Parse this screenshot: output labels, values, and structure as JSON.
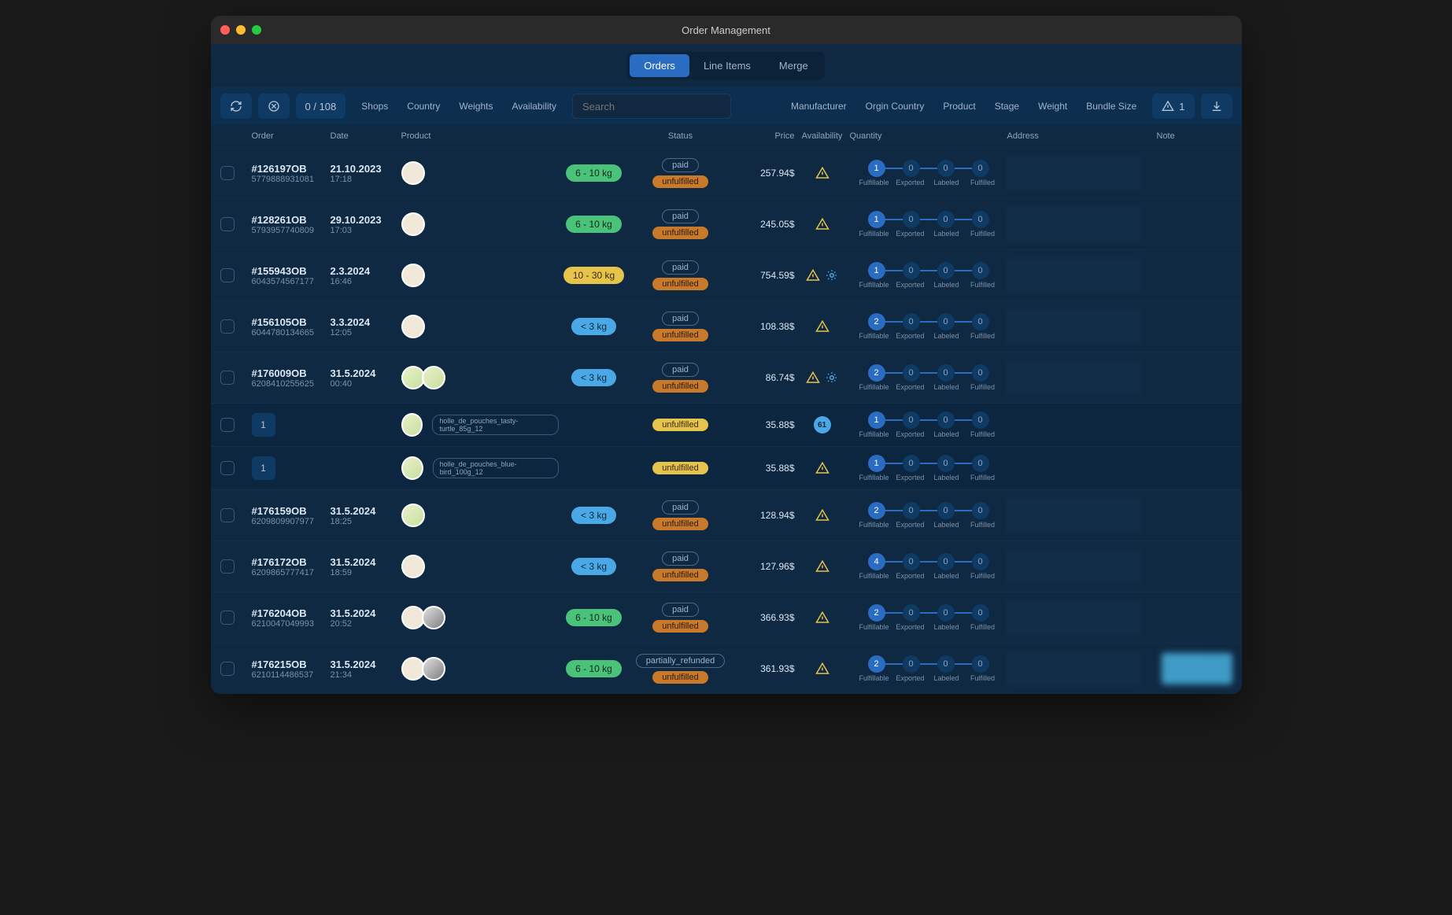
{
  "window": {
    "title": "Order Management"
  },
  "tabs": [
    {
      "label": "Orders",
      "active": true
    },
    {
      "label": "Line Items",
      "active": false
    },
    {
      "label": "Merge",
      "active": false
    }
  ],
  "toolbar": {
    "count": "0 / 108",
    "search_placeholder": "Search",
    "filters_left": [
      "Shops",
      "Country",
      "Weights",
      "Availability"
    ],
    "filters_right": [
      "Manufacturer",
      "Orgin Country",
      "Product",
      "Stage",
      "Weight",
      "Bundle Size"
    ],
    "alert_count": "1"
  },
  "columns": [
    "Order",
    "Date",
    "Product",
    "Status",
    "Price",
    "Availability",
    "Quantity",
    "Address",
    "Note"
  ],
  "qty_labels": [
    "Fulfillable",
    "Exported",
    "Labeled",
    "Fulfilled"
  ],
  "rows": [
    {
      "type": "order",
      "order_id": "#126197OB",
      "order_sub": "5779888931081",
      "date": "21.10.2023",
      "time": "17:18",
      "thumbs": [
        "plain"
      ],
      "weight": "6 - 10 kg",
      "weight_class": "w-green",
      "statuses": [
        {
          "label": "paid",
          "cls": "s-paid"
        },
        {
          "label": "unfulfilled",
          "cls": "s-unf"
        }
      ],
      "price": "257.94$",
      "avail": [
        "warn"
      ],
      "qty": [
        1,
        0,
        0,
        0
      ]
    },
    {
      "type": "order",
      "order_id": "#128261OB",
      "order_sub": "5793957740809",
      "date": "29.10.2023",
      "time": "17:03",
      "thumbs": [
        "plain"
      ],
      "weight": "6 - 10 kg",
      "weight_class": "w-green",
      "statuses": [
        {
          "label": "paid",
          "cls": "s-paid"
        },
        {
          "label": "unfulfilled",
          "cls": "s-unf"
        }
      ],
      "price": "245.05$",
      "avail": [
        "warn"
      ],
      "qty": [
        1,
        0,
        0,
        0
      ]
    },
    {
      "type": "order",
      "order_id": "#155943OB",
      "order_sub": "6043574567177",
      "date": "2.3.2024",
      "time": "16:46",
      "thumbs": [
        "plain"
      ],
      "weight": "10 - 30 kg",
      "weight_class": "w-yellow",
      "statuses": [
        {
          "label": "paid",
          "cls": "s-paid"
        },
        {
          "label": "unfulfilled",
          "cls": "s-unf"
        }
      ],
      "price": "754.59$",
      "avail": [
        "warn",
        "split"
      ],
      "qty": [
        1,
        0,
        0,
        0
      ]
    },
    {
      "type": "order",
      "order_id": "#156105OB",
      "order_sub": "6044780134665",
      "date": "3.3.2024",
      "time": "12:05",
      "thumbs": [
        "plain"
      ],
      "weight": "< 3 kg",
      "weight_class": "w-blue",
      "statuses": [
        {
          "label": "paid",
          "cls": "s-paid"
        },
        {
          "label": "unfulfilled",
          "cls": "s-unf"
        }
      ],
      "price": "108.38$",
      "avail": [
        "warn"
      ],
      "qty": [
        2,
        0,
        0,
        0
      ]
    },
    {
      "type": "order",
      "order_id": "#176009OB",
      "order_sub": "6208410255625",
      "date": "31.5.2024",
      "time": "00:40",
      "thumbs": [
        "pouch",
        "pouch"
      ],
      "weight": "< 3 kg",
      "weight_class": "w-blue",
      "statuses": [
        {
          "label": "paid",
          "cls": "s-paid"
        },
        {
          "label": "unfulfilled",
          "cls": "s-unf"
        }
      ],
      "price": "86.74$",
      "avail": [
        "warn",
        "split"
      ],
      "qty": [
        2,
        0,
        0,
        0
      ]
    },
    {
      "type": "sub",
      "sub_count": "1",
      "thumbs": [
        "pouch"
      ],
      "sku": "holle_de_pouches_tasty-turtle_85g_12",
      "statuses": [
        {
          "label": "unfulfilled",
          "cls": "s-unf-yellow"
        }
      ],
      "price": "35.88$",
      "avail": [
        "count"
      ],
      "avail_count": "61",
      "qty": [
        1,
        0,
        0,
        0
      ]
    },
    {
      "type": "sub",
      "sub_count": "1",
      "thumbs": [
        "pouch"
      ],
      "sku": "holle_de_pouches_blue-bird_100g_12",
      "statuses": [
        {
          "label": "unfulfilled",
          "cls": "s-unf-yellow"
        }
      ],
      "price": "35.88$",
      "avail": [
        "warn"
      ],
      "qty": [
        1,
        0,
        0,
        0
      ]
    },
    {
      "type": "order",
      "order_id": "#176159OB",
      "order_sub": "6209809907977",
      "date": "31.5.2024",
      "time": "18:25",
      "thumbs": [
        "pouch"
      ],
      "weight": "< 3 kg",
      "weight_class": "w-blue",
      "statuses": [
        {
          "label": "paid",
          "cls": "s-paid"
        },
        {
          "label": "unfulfilled",
          "cls": "s-unf"
        }
      ],
      "price": "128.94$",
      "avail": [
        "warn"
      ],
      "qty": [
        2,
        0,
        0,
        0
      ]
    },
    {
      "type": "order",
      "order_id": "#176172OB",
      "order_sub": "6209865777417",
      "date": "31.5.2024",
      "time": "18:59",
      "thumbs": [
        "plain"
      ],
      "weight": "< 3 kg",
      "weight_class": "w-blue",
      "statuses": [
        {
          "label": "paid",
          "cls": "s-paid"
        },
        {
          "label": "unfulfilled",
          "cls": "s-unf"
        }
      ],
      "price": "127.96$",
      "avail": [
        "warn"
      ],
      "qty": [
        4,
        0,
        0,
        0
      ]
    },
    {
      "type": "order",
      "order_id": "#176204OB",
      "order_sub": "6210047049993",
      "date": "31.5.2024",
      "time": "20:52",
      "thumbs": [
        "plain",
        "bw"
      ],
      "weight": "6 - 10 kg",
      "weight_class": "w-green",
      "statuses": [
        {
          "label": "paid",
          "cls": "s-paid"
        },
        {
          "label": "unfulfilled",
          "cls": "s-unf"
        }
      ],
      "price": "366.93$",
      "avail": [
        "warn"
      ],
      "qty": [
        2,
        0,
        0,
        0
      ]
    },
    {
      "type": "order",
      "order_id": "#176215OB",
      "order_sub": "6210114486537",
      "date": "31.5.2024",
      "time": "21:34",
      "thumbs": [
        "plain",
        "bw"
      ],
      "weight": "6 - 10 kg",
      "weight_class": "w-green",
      "statuses": [
        {
          "label": "partially_refunded",
          "cls": "s-partial"
        },
        {
          "label": "unfulfilled",
          "cls": "s-unf"
        }
      ],
      "price": "361.93$",
      "avail": [
        "warn"
      ],
      "qty": [
        2,
        0,
        0,
        0
      ]
    }
  ]
}
